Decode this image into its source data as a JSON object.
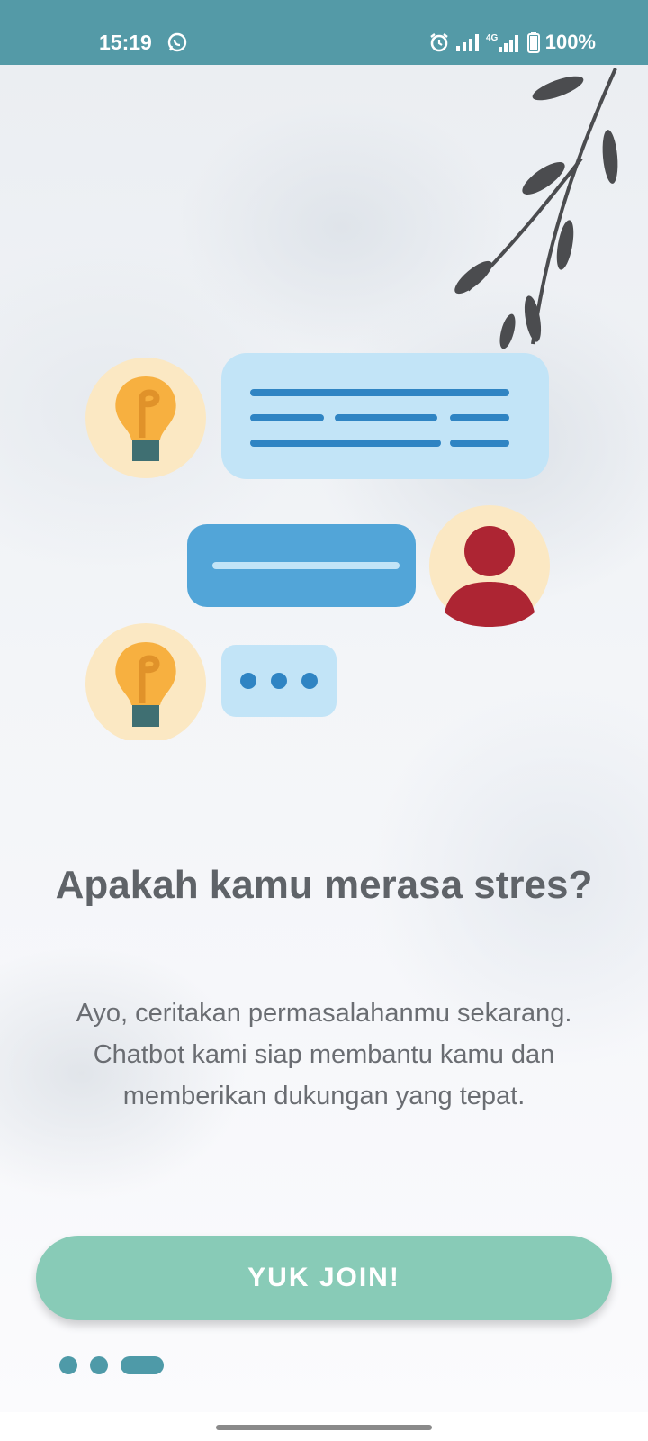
{
  "status_bar": {
    "time": "15:19",
    "network": "4G",
    "battery": "100%",
    "icons": [
      "whatsapp-icon",
      "alarm-icon",
      "signal-icon",
      "lte-signal-icon",
      "battery-icon"
    ]
  },
  "onboarding": {
    "headline": "Apakah kamu merasa stres?",
    "description": "Ayo, ceritakan permasalahanmu sekarang. Chatbot kami siap membantu kamu dan memberikan dukungan yang tepat.",
    "cta_label": "YUK JOIN!",
    "page_count": 3,
    "current_page": 3
  },
  "colors": {
    "status_bar": "#549aa7",
    "button": "#88cbb7",
    "indicator": "#4e9aa8",
    "bubble_light": "#c2e4f7",
    "bubble_mid": "#52a5d8",
    "bubble_lines": "#2f84c3",
    "bulb": "#f7b040",
    "bulb_bg": "#fbe8c3",
    "user_icon": "#ad2533",
    "branch": "#4b4c4f"
  }
}
